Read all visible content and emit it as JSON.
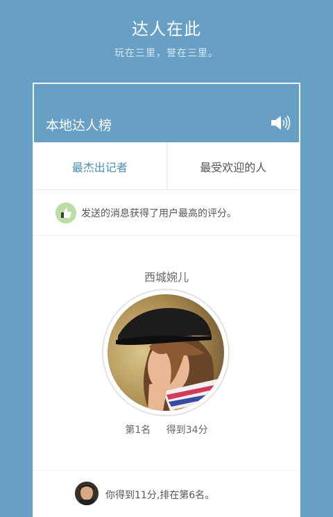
{
  "header": {
    "title": "达人在此",
    "subtitle": "玩在三里，誉在三里。"
  },
  "card": {
    "title": "本地达人榜",
    "speaker_icon": "speaker-icon",
    "tabs": [
      {
        "label": "最杰出记者",
        "active": true
      },
      {
        "label": "最受欢迎的人",
        "active": false
      }
    ],
    "notice": {
      "icon": "thumbs-up-icon",
      "text": "发送的消息获得了用户最高的评分。"
    },
    "winner": {
      "name": "西城婉儿",
      "rank_label": "第1名",
      "score_label": "得到34分"
    },
    "footer": {
      "text": "你得到11分,排在第6名。"
    }
  },
  "colors": {
    "background": "#679fc5",
    "active_tab": "#4a8fc0",
    "thumb_badge": "#b9dfa6"
  }
}
